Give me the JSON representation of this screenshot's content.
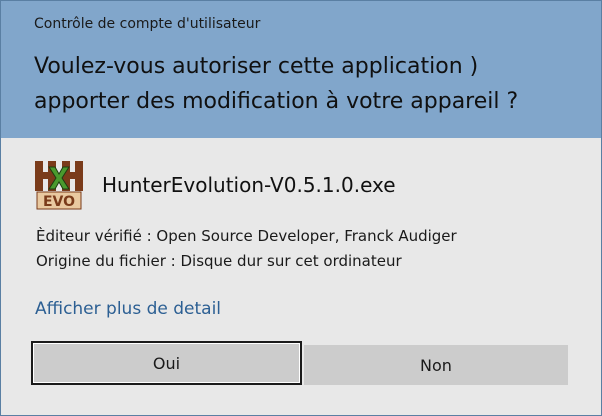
{
  "header": {
    "title": "Contrôle de compte d'utilisateur",
    "question": "Voulez-vous autoriser cette application ) apporter des modification à votre appareil ?"
  },
  "app": {
    "name": "HunterEvolution-V0.5.1.0.exe",
    "icon": "hunter-evolution-logo",
    "icon_text": "EVO"
  },
  "details": {
    "publisher": "Èditeur vérifié : Open Source Developer, Franck Audiger",
    "origin": "Origine du fichier : Disque dur sur cet ordinateur"
  },
  "more_details_link": "Afficher plus de detail",
  "buttons": {
    "yes": "Oui",
    "no": "Non"
  },
  "colors": {
    "header_bg": "#81a6cb",
    "body_bg": "#e8e8e8",
    "link": "#2c5f93",
    "button_bg": "#cccccc",
    "icon_brown": "#7a3b1a",
    "icon_green": "#4a9a2e"
  }
}
